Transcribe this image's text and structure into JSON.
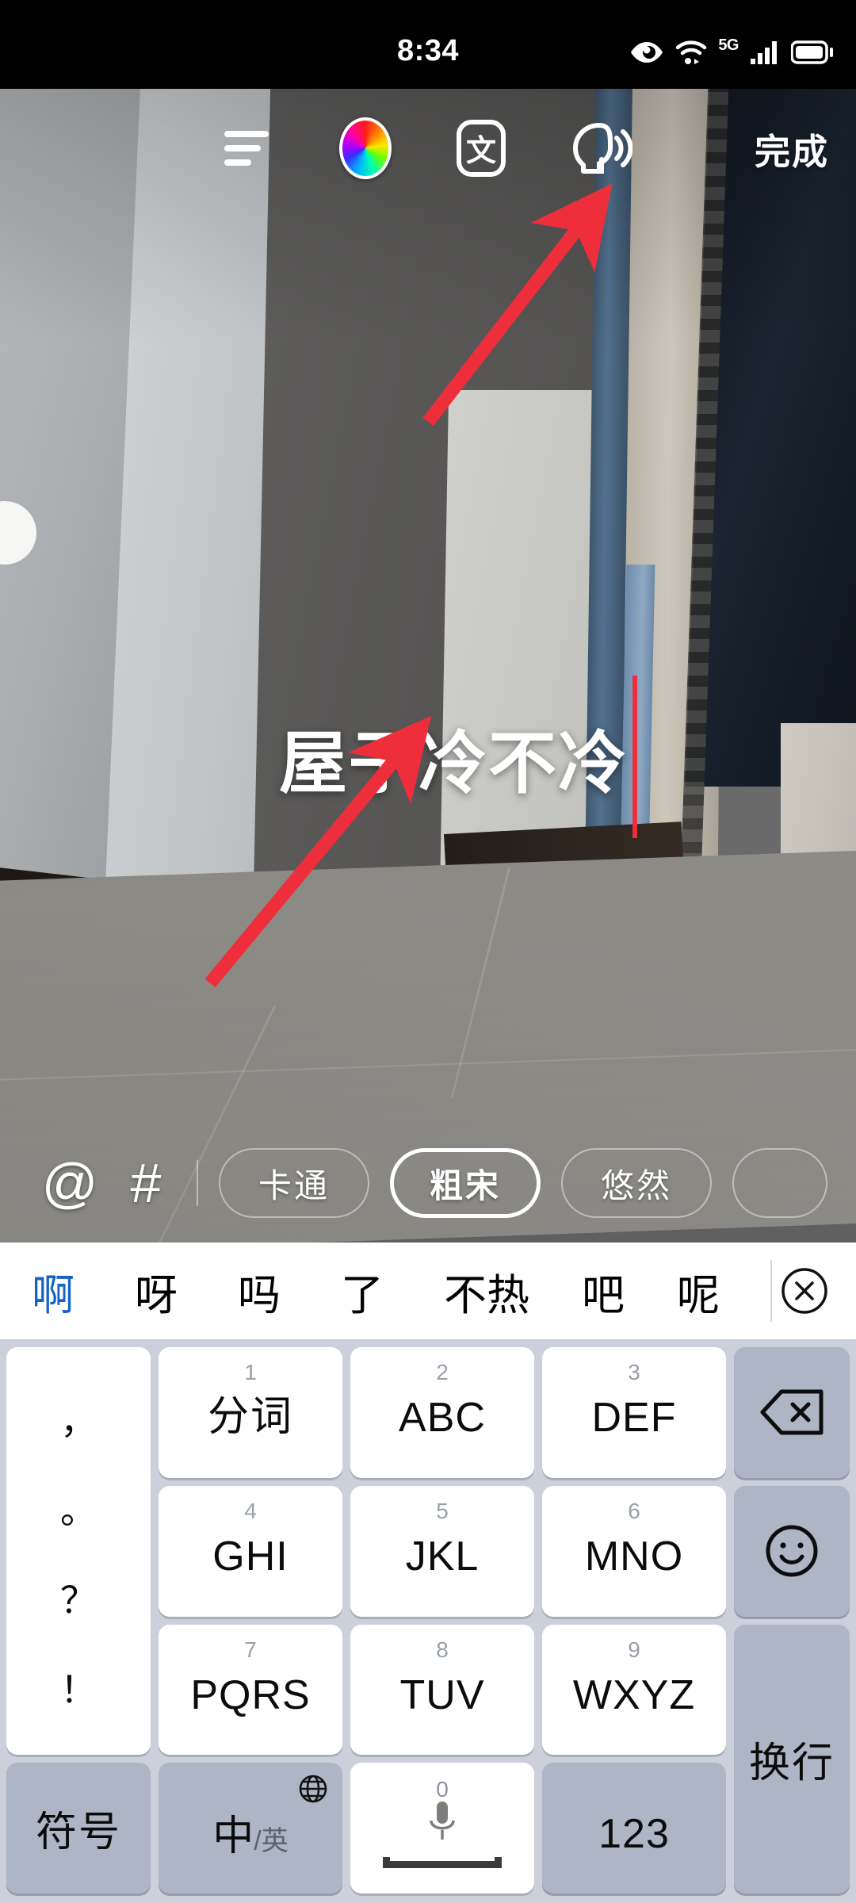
{
  "status_bar": {
    "time": "8:34",
    "icons": [
      "eye-care-icon",
      "wifi-icon",
      "5g-label",
      "signal-bars-icon",
      "battery-icon"
    ],
    "network_label": "5G"
  },
  "editor_toolbar": {
    "align_icon": "text-align-icon",
    "color_icon": "color-wheel-icon",
    "font_style_icon": "text-style-icon",
    "font_style_glyph": "文",
    "tts_icon": "text-to-speech-icon",
    "done_label": "完成"
  },
  "canvas": {
    "overlay_text": "屋子冷不冷",
    "caret_color": "#ec2f3c",
    "annotations": [
      {
        "name": "arrow-to-tts-button",
        "color": "#ee2f3b"
      },
      {
        "name": "arrow-to-overlay-text",
        "color": "#ee2f3b"
      }
    ]
  },
  "font_bar": {
    "mention_label": "@",
    "hashtag_label": "#",
    "chips": [
      {
        "label": "卡通",
        "selected": false
      },
      {
        "label": "粗宋",
        "selected": true
      },
      {
        "label": "悠然",
        "selected": false
      },
      {
        "label": "",
        "selected": false
      }
    ]
  },
  "ime": {
    "candidates": [
      "啊",
      "呀",
      "吗",
      "了",
      "不热",
      "吧",
      "呢"
    ],
    "selected_candidate_index": 0,
    "selected_color": "#1663c7",
    "close_icon": "close-circle-icon",
    "keyboard": {
      "punctuation_key": [
        "，",
        "。",
        "？",
        "！"
      ],
      "rows": [
        [
          {
            "num": "1",
            "label": "分词",
            "type": "normal"
          },
          {
            "num": "2",
            "label": "ABC",
            "type": "normal"
          },
          {
            "num": "3",
            "label": "DEF",
            "type": "normal"
          },
          {
            "num": "",
            "label": "",
            "type": "fn",
            "icon": "backspace-icon"
          }
        ],
        [
          {
            "num": "4",
            "label": "GHI",
            "type": "normal"
          },
          {
            "num": "5",
            "label": "JKL",
            "type": "normal"
          },
          {
            "num": "6",
            "label": "MNO",
            "type": "normal"
          },
          {
            "num": "",
            "label": "",
            "type": "fn",
            "icon": "emoji-icon"
          }
        ],
        [
          {
            "num": "7",
            "label": "PQRS",
            "type": "normal"
          },
          {
            "num": "8",
            "label": "TUV",
            "type": "normal"
          },
          {
            "num": "9",
            "label": "WXYZ",
            "type": "normal"
          },
          {
            "num": "",
            "label": "换行",
            "type": "fn"
          }
        ],
        [
          {
            "num": "",
            "label": "符号",
            "type": "fn"
          },
          {
            "num": "",
            "label": "中",
            "sub": "/英",
            "type": "fn",
            "icon": "globe-icon"
          },
          {
            "num": "0",
            "label": "",
            "type": "space",
            "icon": "microphone-icon"
          },
          {
            "num": "",
            "label": "123",
            "type": "fn"
          }
        ]
      ]
    }
  }
}
